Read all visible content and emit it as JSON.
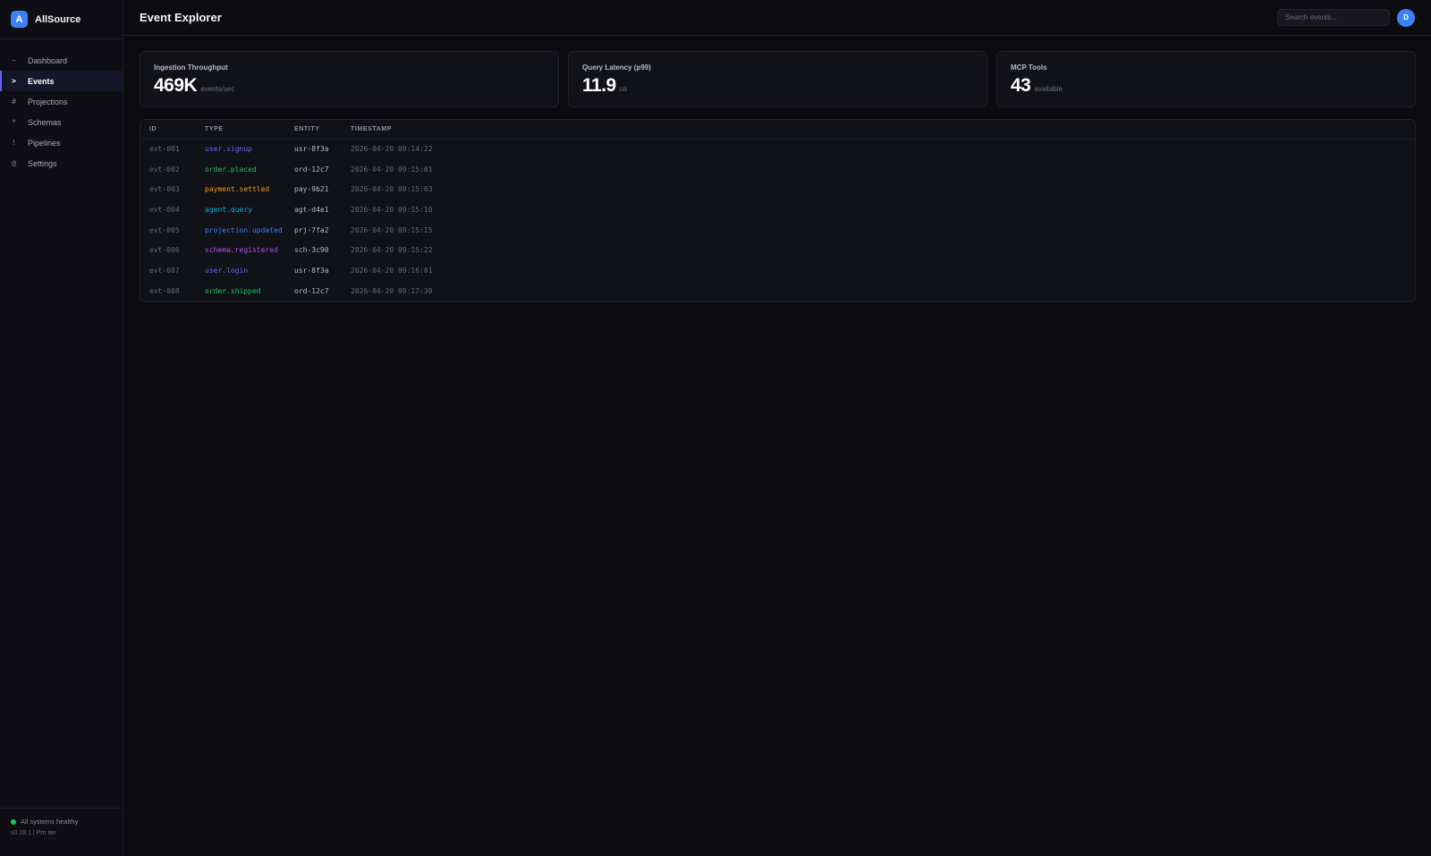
{
  "brand": {
    "logo_letter": "A",
    "name": "AllSource",
    "color": "#3b82f6"
  },
  "sidebar": {
    "items": [
      {
        "icon": "~",
        "icon_name": "wave-icon",
        "label": "Dashboard",
        "active": false
      },
      {
        "icon": ">",
        "icon_name": "chevron-right-icon",
        "label": "Events",
        "active": true
      },
      {
        "icon": "#",
        "icon_name": "hash-icon",
        "label": "Projections",
        "active": false
      },
      {
        "icon": "*",
        "icon_name": "asterisk-icon",
        "label": "Schemas",
        "active": false
      },
      {
        "icon": "!",
        "icon_name": "exclamation-icon",
        "label": "Pipelines",
        "active": false
      },
      {
        "icon": "@",
        "icon_name": "at-icon",
        "label": "Settings",
        "active": false
      }
    ],
    "footer": {
      "status": "All systems healthy",
      "status_color": "#22c55e",
      "version": "v0.19.1 | Pro tier"
    }
  },
  "header": {
    "title": "Event Explorer",
    "search_placeholder": "Search events...",
    "avatar_letter": "D"
  },
  "stats": [
    {
      "label": "Ingestion Throughput",
      "value": "469K",
      "unit": "events/sec"
    },
    {
      "label": "Query Latency (p99)",
      "value": "11.9",
      "unit": "us"
    },
    {
      "label": "MCP Tools",
      "value": "43",
      "unit": "available"
    }
  ],
  "table": {
    "columns": [
      "ID",
      "TYPE",
      "ENTITY",
      "TIMESTAMP"
    ],
    "rows": [
      {
        "id": "evt-001",
        "type": "user.signup",
        "type_color": "#6366f1",
        "entity": "usr-8f3a",
        "timestamp": "2026-04-20 09:14:22"
      },
      {
        "id": "evt-002",
        "type": "order.placed",
        "type_color": "#22c55e",
        "entity": "ord-12c7",
        "timestamp": "2026-04-20 09:15:01"
      },
      {
        "id": "evt-003",
        "type": "payment.settled",
        "type_color": "#f59e0b",
        "entity": "pay-9b21",
        "timestamp": "2026-04-20 09:15:03"
      },
      {
        "id": "evt-004",
        "type": "agent.query",
        "type_color": "#06b6d4",
        "entity": "agt-d4e1",
        "timestamp": "2026-04-20 09:15:10"
      },
      {
        "id": "evt-005",
        "type": "projection.updated",
        "type_color": "#3b82f6",
        "entity": "prj-7fa2",
        "timestamp": "2026-04-20 09:15:15"
      },
      {
        "id": "evt-006",
        "type": "schema.registered",
        "type_color": "#a855f7",
        "entity": "sch-3c90",
        "timestamp": "2026-04-20 09:15:22"
      },
      {
        "id": "evt-007",
        "type": "user.login",
        "type_color": "#6366f1",
        "entity": "usr-8f3a",
        "timestamp": "2026-04-20 09:16:01"
      },
      {
        "id": "evt-008",
        "type": "order.shipped",
        "type_color": "#22c55e",
        "entity": "ord-12c7",
        "timestamp": "2026-04-20 09:17:30"
      }
    ]
  }
}
